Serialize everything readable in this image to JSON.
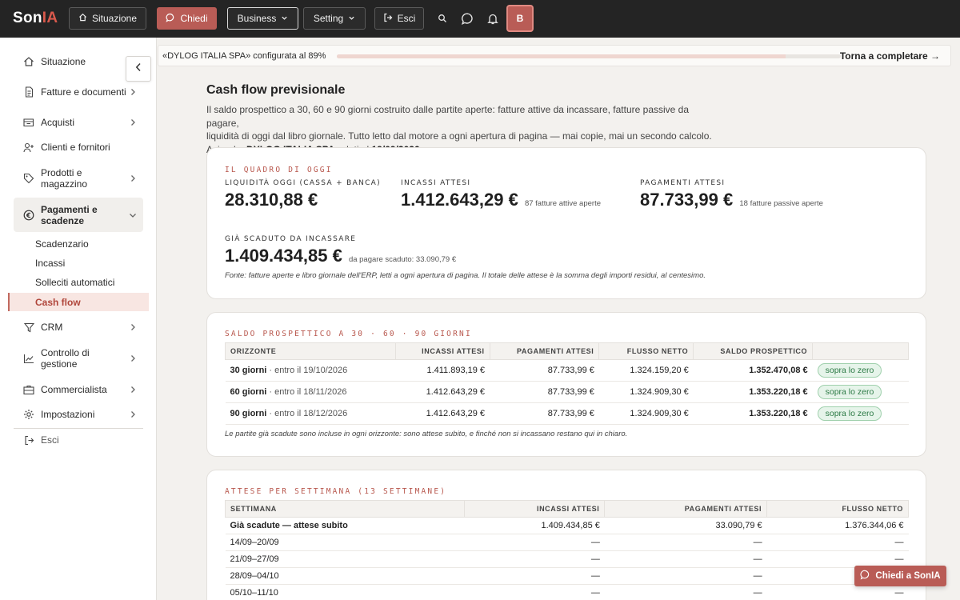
{
  "app": {
    "logo_main": "Son",
    "logo_accent": "IA",
    "brand_color": "#b95c56",
    "topbar_color": "#242424"
  },
  "topbar": {
    "situazione": "Situazione",
    "chiedi": "Chiedi",
    "business": "Business",
    "setting": "Setting",
    "esci": "Esci",
    "avatar_initial": "B"
  },
  "sidebar": {
    "items": [
      {
        "label": "Situazione",
        "icon": "home-icon"
      },
      {
        "label": "Fatture e documenti",
        "icon": "document-icon"
      },
      {
        "label": "Acquisti",
        "icon": "cart-icon"
      },
      {
        "label": "Clienti e fornitori",
        "icon": "user-plus-icon"
      },
      {
        "label": "Prodotti e magazzino",
        "icon": "tag-icon"
      },
      {
        "label": "Pagamenti e scadenze",
        "icon": "euro-icon"
      },
      {
        "label": "CRM",
        "icon": "funnel-icon"
      },
      {
        "label": "Controllo di gestione",
        "icon": "chart-line-icon"
      },
      {
        "label": "Commercialista",
        "icon": "briefcase-icon"
      },
      {
        "label": "Impostazioni",
        "icon": "gear-icon"
      },
      {
        "label": "Esci",
        "icon": "logout-icon"
      }
    ],
    "subitems": [
      "Scadenzario",
      "Incassi",
      "Solleciti automatici",
      "Cash flow"
    ],
    "active_subitem": "Cash flow"
  },
  "progress": {
    "text": "«DYLOG ITALIA SPA» configurata al 89%",
    "percent": 89,
    "link": "Torna a completare →"
  },
  "page": {
    "title": "Cash flow previsionale",
    "intro_line1": "Il saldo prospettico a 30, 60 e 90 giorni costruito dalle partite aperte: fatture attive da incassare, fatture passive da pagare,",
    "intro_line2": "liquidità di oggi dal libro giornale. Tutto letto dal motore a ogni apertura di pagina — mai copie, mai un secondo calcolo.",
    "azienda_label": "Azienda:",
    "azienda": "DYLOG ITALIA SPA",
    "dati_al_label": "· dati al",
    "date": "19/09/2026"
  },
  "quadro": {
    "kicker": "IL QUADRO DI OGGI",
    "liquidita_label": "LIQUIDITÀ OGGI (CASSA + BANCA)",
    "liquidita_value": "28.310,88 €",
    "incassi_label": "INCASSI ATTESI",
    "incassi_value": "1.412.643,29 €",
    "incassi_note": "87 fatture attive aperte",
    "pagamenti_label": "PAGAMENTI ATTESI",
    "pagamenti_value": "87.733,99 €",
    "pagamenti_note": "18 fatture passive aperte",
    "scaduto_label": "GIÀ SCADUTO DA INCASSARE",
    "scaduto_value": "1.409.434,85 €",
    "scaduto_note": "da pagare scaduto: 33.090,79 €",
    "fonte": "Fonte: fatture aperte e libro giornale dell'ERP, letti a ogni apertura di pagina. Il totale delle attese è la somma degli importi residui, al centesimo."
  },
  "saldo": {
    "kicker": "SALDO PROSPETTICO A 30 · 60 · 90 GIORNI",
    "headers": [
      "ORIZZONTE",
      "INCASSI ATTESI",
      "PAGAMENTI ATTESI",
      "FLUSSO NETTO",
      "SALDO PROSPETTICO",
      ""
    ],
    "rows": [
      {
        "giorni": "30 giorni",
        "entro": "· entro il 19/10/2026",
        "incassi": "1.411.893,19 €",
        "pagamenti": "87.733,99 €",
        "flusso": "1.324.159,20 €",
        "saldo": "1.352.470,08 €",
        "stato": "sopra lo zero"
      },
      {
        "giorni": "60 giorni",
        "entro": "· entro il 18/11/2026",
        "incassi": "1.412.643,29 €",
        "pagamenti": "87.733,99 €",
        "flusso": "1.324.909,30 €",
        "saldo": "1.353.220,18 €",
        "stato": "sopra lo zero"
      },
      {
        "giorni": "90 giorni",
        "entro": "· entro il 18/12/2026",
        "incassi": "1.412.643,29 €",
        "pagamenti": "87.733,99 €",
        "flusso": "1.324.909,30 €",
        "saldo": "1.353.220,18 €",
        "stato": "sopra lo zero"
      }
    ],
    "note": "Le partite già scadute sono incluse in ogni orizzonte: sono attese subito, e finché non si incassano restano qui in chiaro."
  },
  "settimane": {
    "kicker": "ATTESE PER SETTIMANA (13 SETTIMANE)",
    "headers": [
      "SETTIMANA",
      "INCASSI ATTESI",
      "PAGAMENTI ATTESI",
      "FLUSSO NETTO"
    ],
    "rows": [
      {
        "settimana": "Già scadute — attese subito",
        "incassi": "1.409.434,85 €",
        "pagamenti": "33.090,79 €",
        "flusso": "1.376.344,06 €"
      },
      {
        "settimana": "14/09–20/09",
        "incassi": "—",
        "pagamenti": "—",
        "flusso": "—"
      },
      {
        "settimana": "21/09–27/09",
        "incassi": "—",
        "pagamenti": "—",
        "flusso": "—"
      },
      {
        "settimana": "28/09–04/10",
        "incassi": "—",
        "pagamenti": "—",
        "flusso": "—"
      },
      {
        "settimana": "05/10–11/10",
        "incassi": "—",
        "pagamenti": "—",
        "flusso": "—"
      }
    ]
  },
  "chat": {
    "label": "Chiedi a SonIA"
  }
}
